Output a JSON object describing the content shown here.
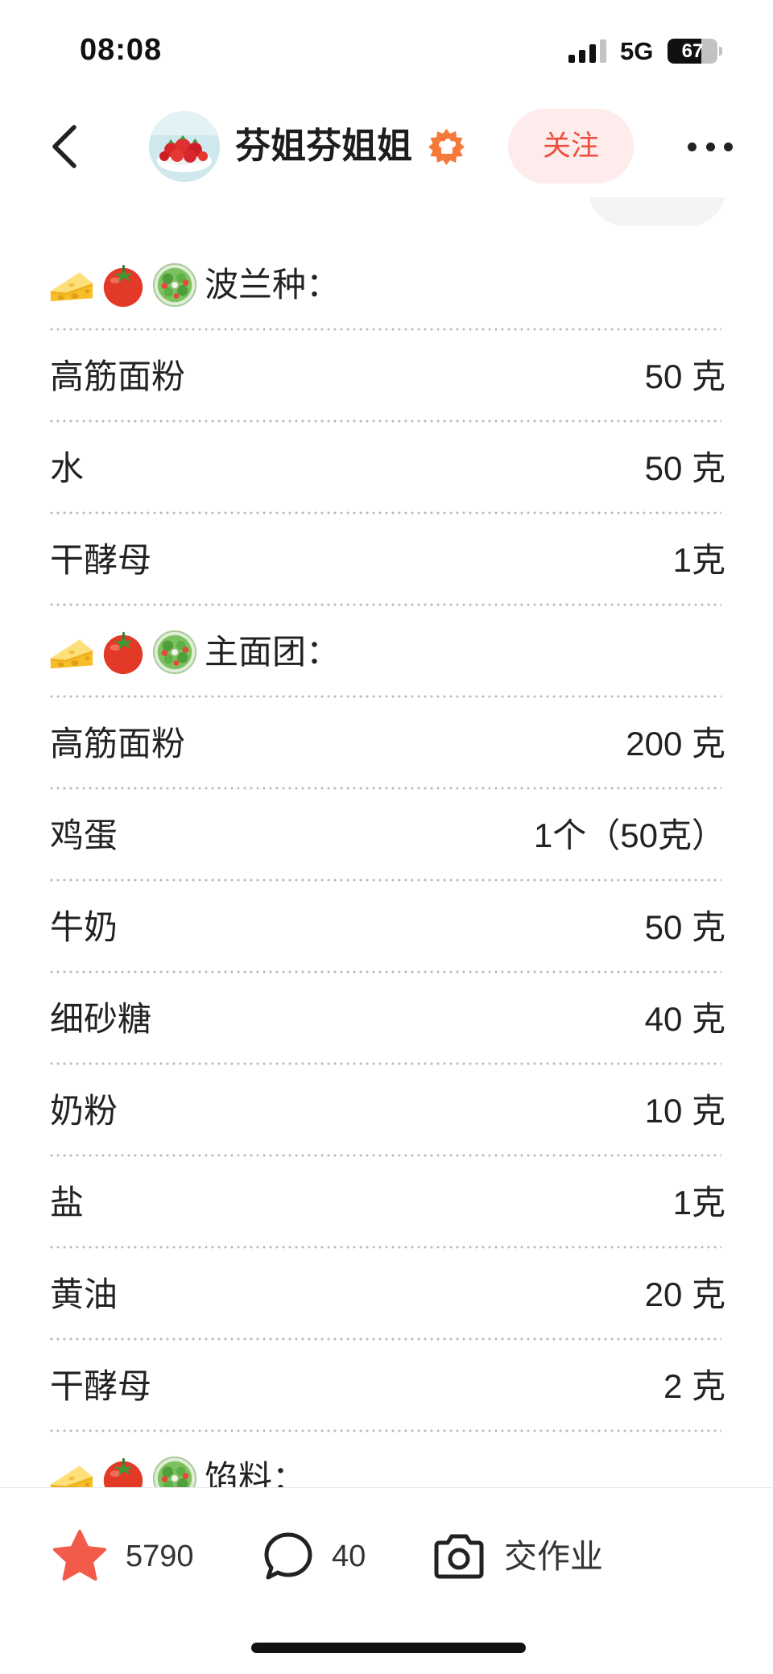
{
  "status_bar": {
    "time": "08:08",
    "network": "5G",
    "battery": "67"
  },
  "header": {
    "author_name": "芬姐芬姐姐",
    "follow_label": "关注",
    "icons": [
      "back-chevron-icon",
      "chef-badge-icon",
      "more-icon"
    ]
  },
  "recipe": {
    "section_icons": [
      "cheese-icon",
      "tomato-icon",
      "salad-icon"
    ],
    "sections": [
      {
        "title": "波兰种：",
        "items": [
          {
            "name": "高筋面粉",
            "amount": "50 克"
          },
          {
            "name": "水",
            "amount": "50 克"
          },
          {
            "name": "干酵母",
            "amount": "1克"
          }
        ]
      },
      {
        "title": "主面团：",
        "items": [
          {
            "name": "高筋面粉",
            "amount": "200 克"
          },
          {
            "name": "鸡蛋",
            "amount": "1个（50克）"
          },
          {
            "name": "牛奶",
            "amount": "50 克"
          },
          {
            "name": "细砂糖",
            "amount": "40 克"
          },
          {
            "name": "奶粉",
            "amount": "10 克"
          },
          {
            "name": "盐",
            "amount": "1克"
          },
          {
            "name": "黄油",
            "amount": "20 克"
          },
          {
            "name": "干酵母",
            "amount": "2 克"
          }
        ]
      },
      {
        "title": "馅料：",
        "items": []
      }
    ]
  },
  "bottom_bar": {
    "likes": "5790",
    "comments": "40",
    "homework_label": "交作业",
    "icons": [
      "star-icon",
      "comment-icon",
      "camera-icon"
    ]
  },
  "colors": {
    "accent": "#ee4c3d",
    "follow_bg": "#fdeceb",
    "like_star": "#f25a4a",
    "badge": "#f5793a"
  }
}
